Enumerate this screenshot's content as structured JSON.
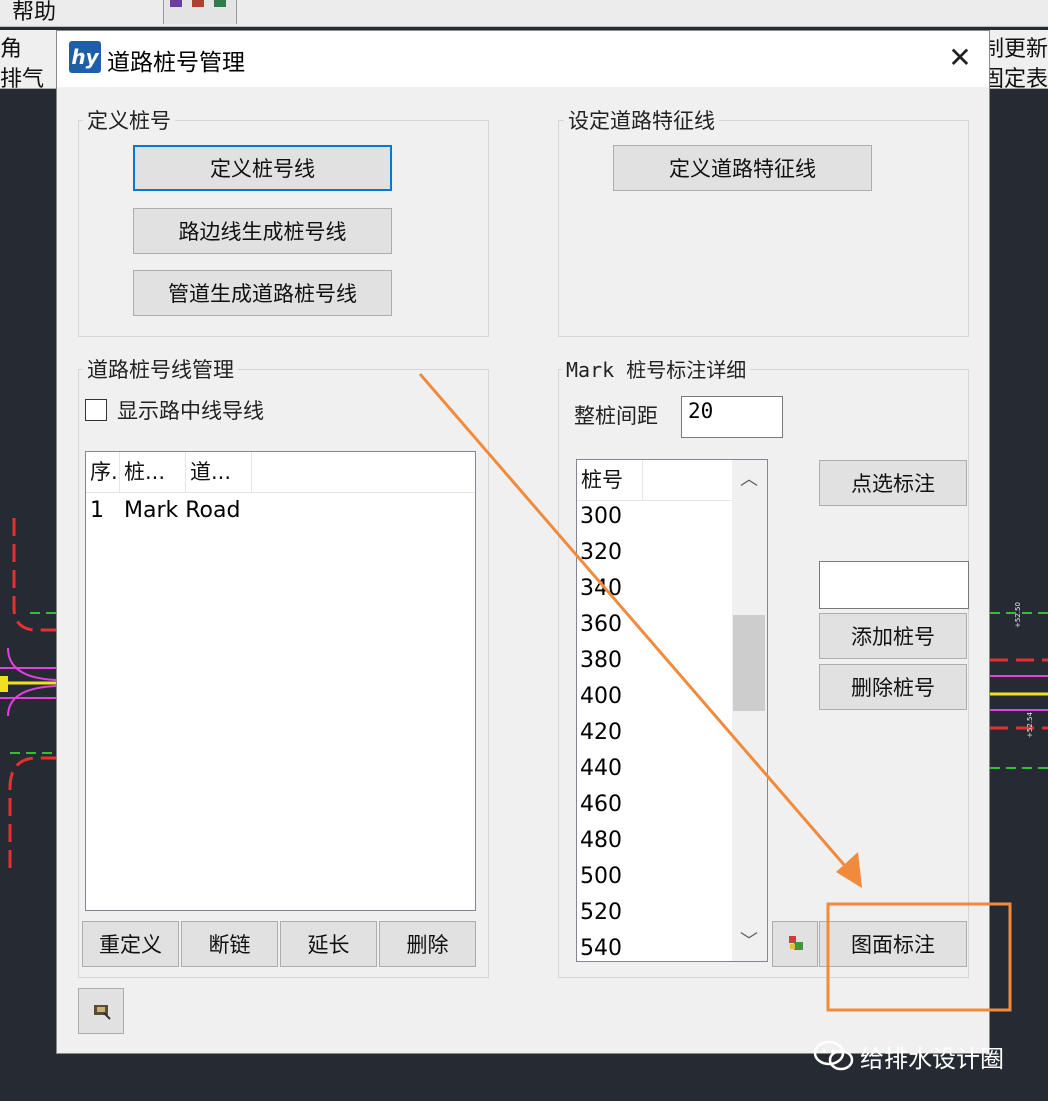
{
  "background": {
    "menu_help": "帮助",
    "strip_left_1": "角",
    "strip_left_2": "排气",
    "strip_right_1": "制更新",
    "strip_right_2": "固定表",
    "cad_label_right_1": "+52.50",
    "cad_label_right_2": "+52.54"
  },
  "dialog": {
    "title": "道路桩号管理",
    "logo_text": "hy",
    "close_glyph": "✕"
  },
  "define_group": {
    "legend": "定义桩号",
    "btn_define_line": "定义桩号线",
    "btn_edge_generate": "路边线生成桩号线",
    "btn_pipe_generate": "管道生成道路桩号线"
  },
  "feature_group": {
    "legend": "设定道路特征线",
    "btn_define_feature": "定义道路特征线"
  },
  "manage_group": {
    "legend": "道路桩号线管理",
    "show_centerline_label": "显示路中线导线",
    "show_centerline_checked": false,
    "columns": [
      "序.",
      "桩...",
      "道..."
    ],
    "rows": [
      {
        "index": "1",
        "name": "Mark Road"
      }
    ],
    "btn_redefine": "重定义",
    "btn_break_chain": "断链",
    "btn_extend": "延长",
    "btn_delete": "删除"
  },
  "mark_group": {
    "legend": "Mark  桩号标注详细",
    "spacing_label": "整桩间距",
    "spacing_value": "20",
    "column": "桩号",
    "stations": [
      "300",
      "320",
      "340",
      "360",
      "380",
      "400",
      "420",
      "440",
      "460",
      "480",
      "500",
      "520",
      "540"
    ],
    "btn_pick_mark": "点选标注",
    "new_station_value": "",
    "btn_add_station": "添加桩号",
    "btn_delete_station": "删除桩号",
    "btn_drawing_mark": "图面标注",
    "scroll_up_glyph": "︿",
    "scroll_down_glyph": "﹀"
  },
  "watermark": {
    "text": "给排水设计圈"
  },
  "colors": {
    "arrow": "#f08a3c",
    "highlight_box": "#f08a3c",
    "default_button_border": "#0078d7",
    "logo_blue": "#1f5fa8"
  }
}
